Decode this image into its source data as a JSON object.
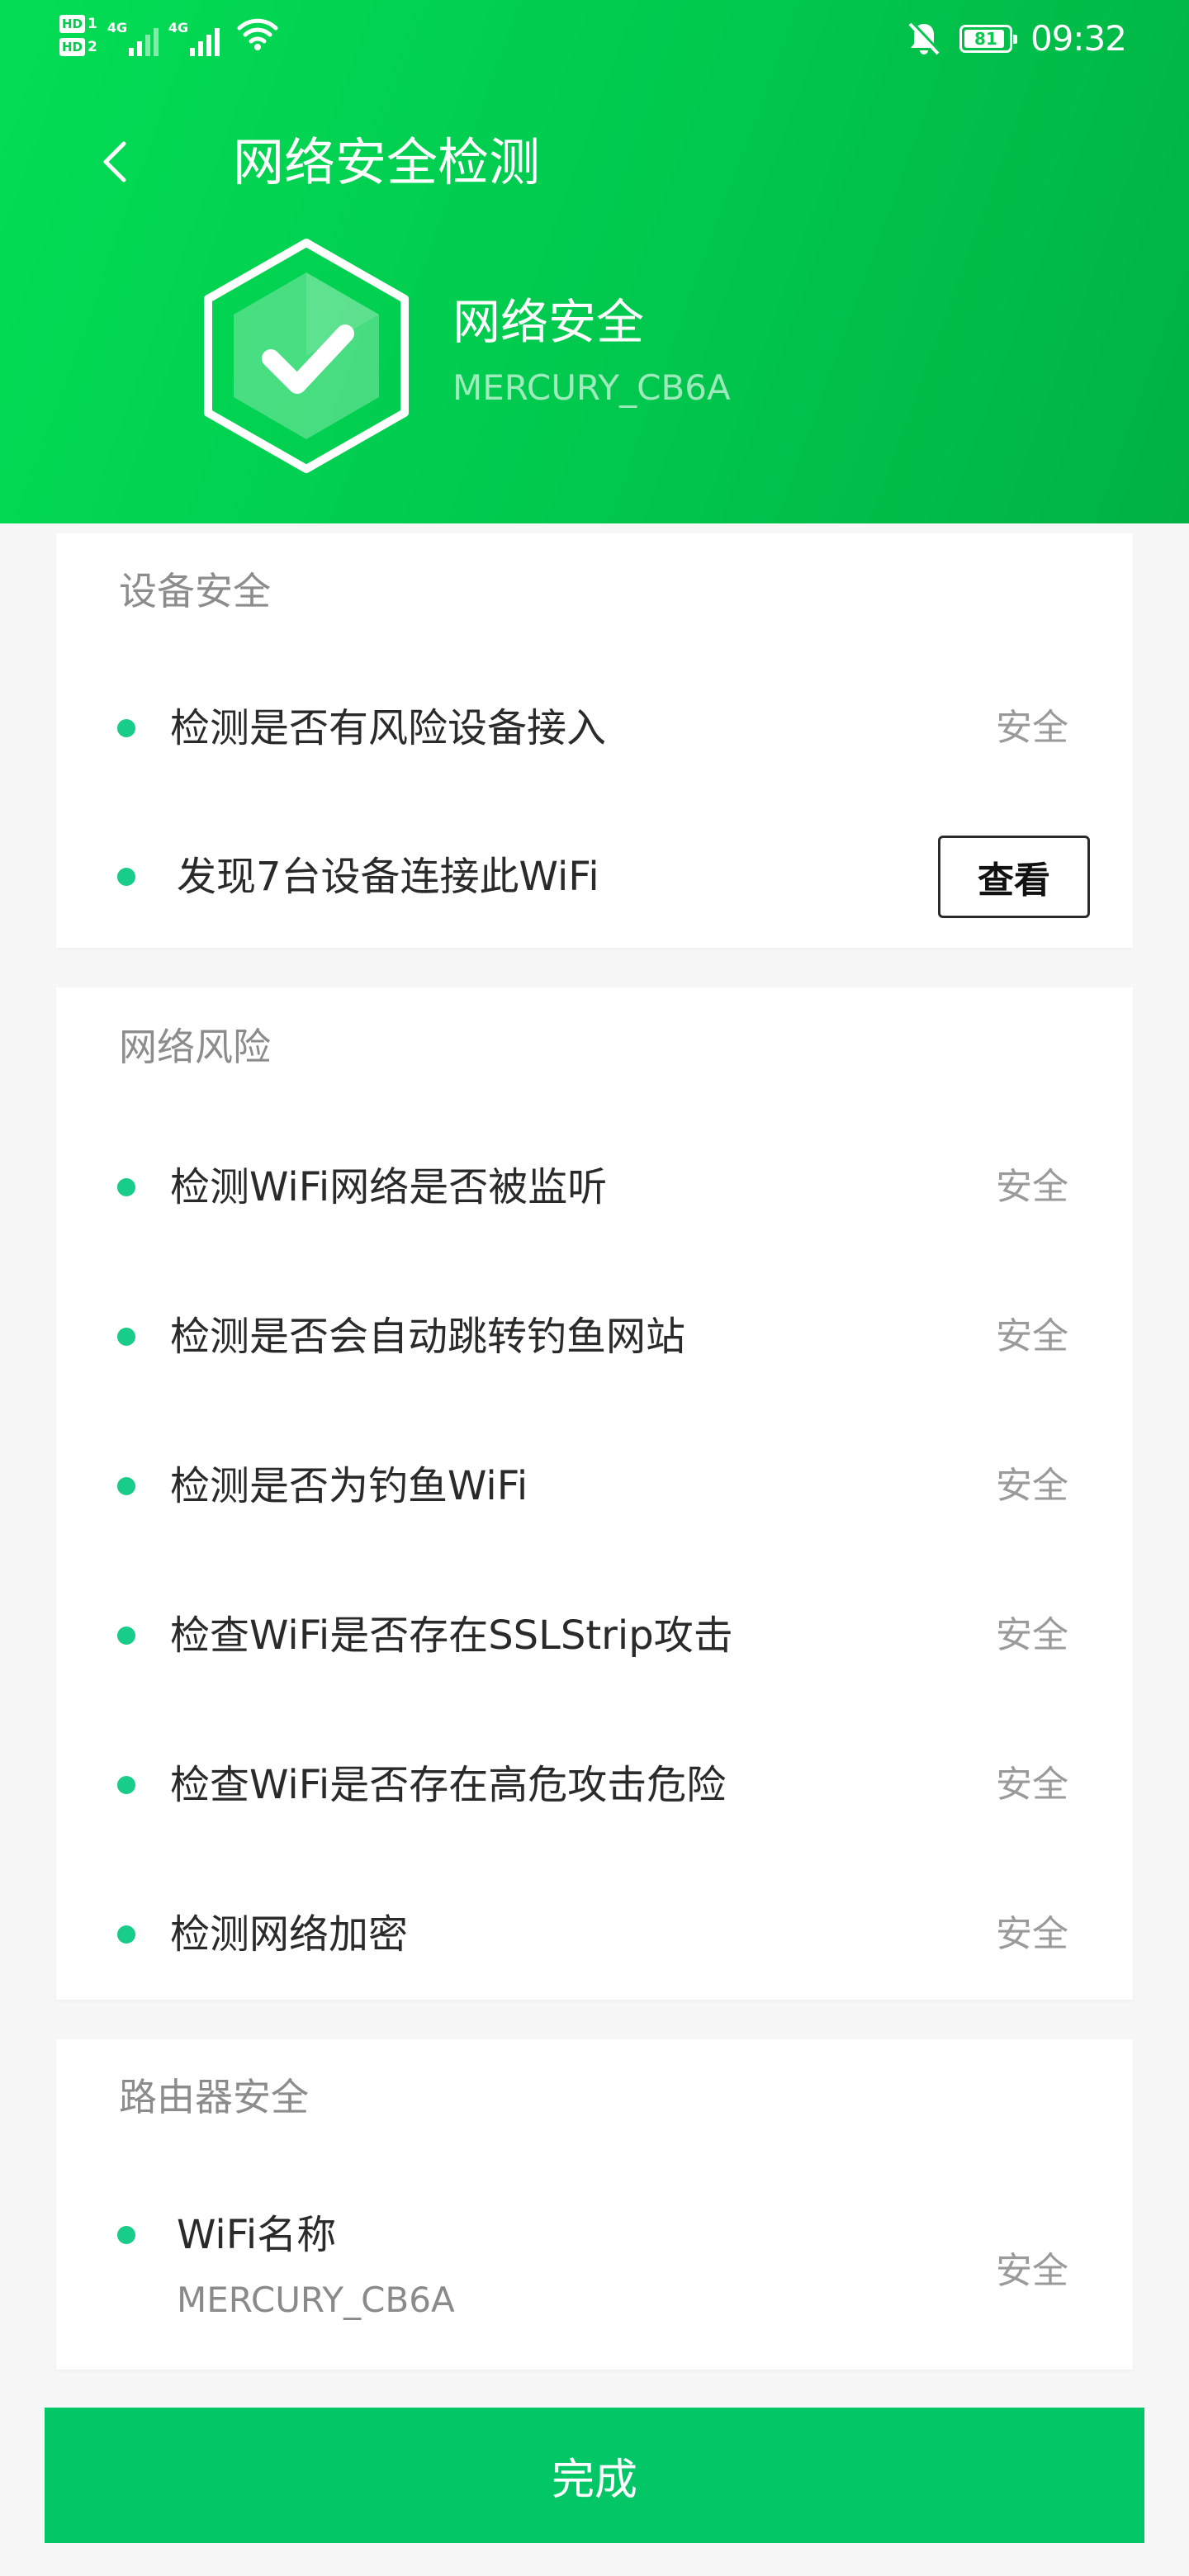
{
  "status_bar": {
    "sim1": "HD",
    "sim1_num": "1",
    "sim2": "HD",
    "sim2_num": "2",
    "net1": "4G",
    "net2": "4G",
    "battery": "81",
    "time": "09:32"
  },
  "header": {
    "title": "网络安全检测",
    "result_title": "网络安全",
    "ssid": "MERCURY_CB6A",
    "accent": "#00c84e"
  },
  "sections": [
    {
      "title": "设备安全",
      "items": [
        {
          "label": "检测是否有风险设备接入",
          "status": "安全"
        },
        {
          "label": "发现7台设备连接此WiFi",
          "action": "查看"
        }
      ]
    },
    {
      "title": "网络风险",
      "items": [
        {
          "label": "检测WiFi网络是否被监听",
          "status": "安全"
        },
        {
          "label": "检测是否会自动跳转钓鱼网站",
          "status": "安全"
        },
        {
          "label": "检测是否为钓鱼WiFi",
          "status": "安全"
        },
        {
          "label": "检查WiFi是否存在SSLStrip攻击",
          "status": "安全"
        },
        {
          "label": "检查WiFi是否存在高危攻击危险",
          "status": "安全"
        },
        {
          "label": "检测网络加密",
          "status": "安全"
        }
      ]
    },
    {
      "title": "路由器安全",
      "items": [
        {
          "label": "WiFi名称",
          "sub": "MERCURY_CB6A",
          "status": "安全"
        }
      ]
    }
  ],
  "footer": {
    "done_label": "完成",
    "button_color": "#03c766"
  },
  "icons": [
    "back-arrow-icon",
    "shield-check-icon",
    "mute-bell-icon",
    "wifi-signal-icon",
    "battery-icon"
  ]
}
